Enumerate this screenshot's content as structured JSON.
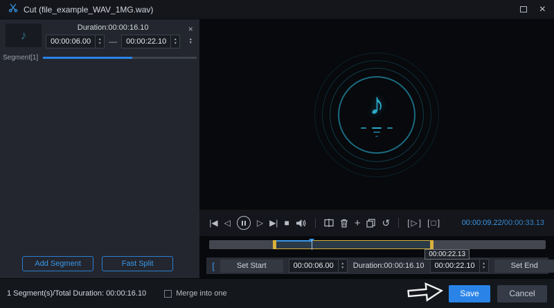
{
  "colors": {
    "accent": "#2a84e8",
    "teal": "#2aa9c9",
    "handle_yellow": "#d9b13b"
  },
  "window": {
    "title": "Cut (file_example_WAV_1MG.wav)",
    "close_glyph": "×"
  },
  "segment_panel": {
    "duration_label": "Duration:00:00:16.10",
    "start_time": "00:00:06.00",
    "range_dash": "—",
    "end_time": "00:00:22.10",
    "segment_label": "Segment[1]",
    "remove_glyph": "×",
    "reorder_up_glyph": "▴",
    "reorder_down_glyph": "▾",
    "thumb_note_glyph": "♪",
    "add_segment_label": "Add Segment",
    "fast_split_label": "Fast Split"
  },
  "preview": {
    "note_glyph": "♪"
  },
  "player": {
    "current_time": "00:00:09.22",
    "time_separator": "/",
    "total_time": "00:00:33.13",
    "icons": {
      "prev": "|◀",
      "step_back": "◁",
      "step_forward": "▷",
      "next": "▶|",
      "stop": "■",
      "plus": "+",
      "undo": "↺",
      "bracket_open": "[",
      "bracket_close": "]",
      "play_segment": "▷",
      "stop_segment": "□"
    }
  },
  "spinner": {
    "up": "▴",
    "down": "▾"
  },
  "timeline": {
    "tooltip": "00:00:22.13"
  },
  "trim": {
    "bracket_open": "[",
    "set_start_label": "Set Start",
    "start_time": "00:00:06.00",
    "duration_label": "Duration:00:00:16.10",
    "end_time": "00:00:22.10",
    "set_end_label": "Set End",
    "bracket_close": "]"
  },
  "footer": {
    "summary": "1 Segment(s)/Total Duration: 00:00:16.10",
    "merge_label": "Merge into one",
    "save_label": "Save",
    "cancel_label": "Cancel"
  }
}
